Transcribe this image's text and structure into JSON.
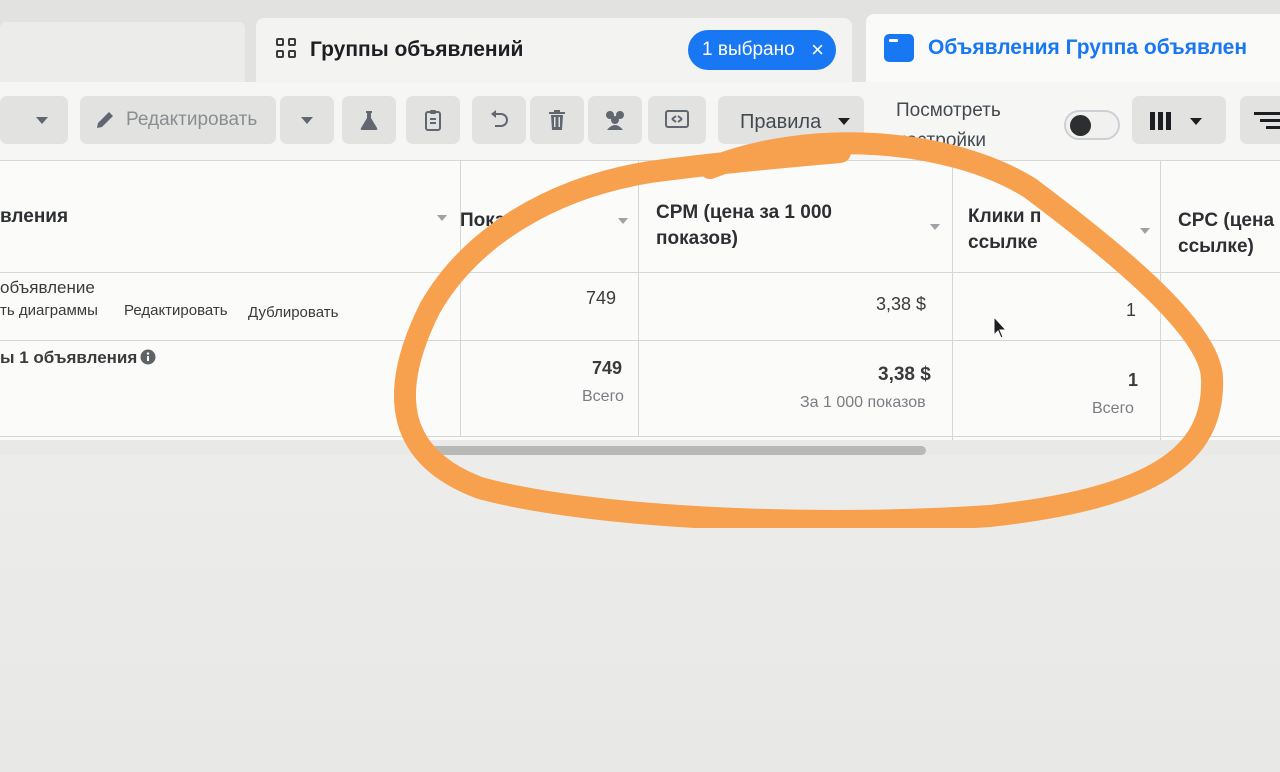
{
  "tabs": {
    "groups": {
      "label": "Группы объявлений",
      "icon": "grid-icon"
    },
    "selection_chip": {
      "label": "1 выбрано",
      "close_icon": "close-icon"
    },
    "ads": {
      "label": "Объявления Группа объявлен",
      "icon": "ad-card-icon"
    }
  },
  "toolbar": {
    "edit_label": "Редактировать",
    "rules_label": "Правила",
    "view_settings_line1": "Посмотреть",
    "view_settings_line2": "настройки",
    "icons": [
      "pencil-icon",
      "flask-icon",
      "clipboard-icon",
      "undo-icon",
      "trash-icon",
      "people-icon",
      "export-icon",
      "columns-icon",
      "menu-icon"
    ]
  },
  "table": {
    "columns": {
      "name": "вления",
      "impressions": "Показ",
      "cpm_line1": "CPM (цена за 1 000",
      "cpm_line2": "показов)",
      "clicks_line1": "Клики п",
      "clicks_line2": "ссылке",
      "cpc_line1": "CPC (цена",
      "cpc_line2": "ссылке)"
    },
    "row": {
      "name": "объявление",
      "actions": [
        "ть диаграммы",
        "Редактировать",
        "Дублировать"
      ],
      "impressions": "749",
      "cpm": "3,38 $",
      "clicks": "1"
    },
    "summary": {
      "label": "ы 1 объявления",
      "impressions": "749",
      "impressions_sub": "Всего",
      "cpm": "3,38 $",
      "cpm_sub": "За 1 000 показов",
      "clicks": "1",
      "clicks_sub": "Всего"
    }
  },
  "colors": {
    "accent_blue": "#1877f2",
    "annotation_orange": "#f7a04d"
  }
}
